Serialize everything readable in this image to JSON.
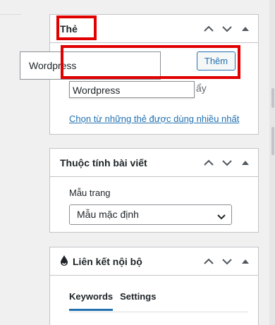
{
  "tags_panel": {
    "title": "Thẻ",
    "input_value": "Wordpress",
    "add_button": "Thêm",
    "suggestion": "Wordpress",
    "hint_fragment": "ẩy",
    "choose_link": "Chọn từ những thẻ được dùng nhiều nhất"
  },
  "post_attributes_panel": {
    "title": "Thuộc tính bài viết",
    "template_label": "Mẫu trang",
    "template_value": "Mẫu mặc định"
  },
  "internal_links_panel": {
    "title": "Liên kết nội bộ",
    "tabs": [
      {
        "label": "Keywords",
        "active": true
      },
      {
        "label": "Settings",
        "active": false
      }
    ]
  },
  "icons": {
    "move_up": "chevron-up-icon",
    "move_down": "chevron-down-icon",
    "toggle": "triangle-up-icon",
    "panel_logo": "drop-icon"
  },
  "colors": {
    "highlight": "#e00000",
    "accent": "#2271b1",
    "border": "#c3c4c7"
  }
}
